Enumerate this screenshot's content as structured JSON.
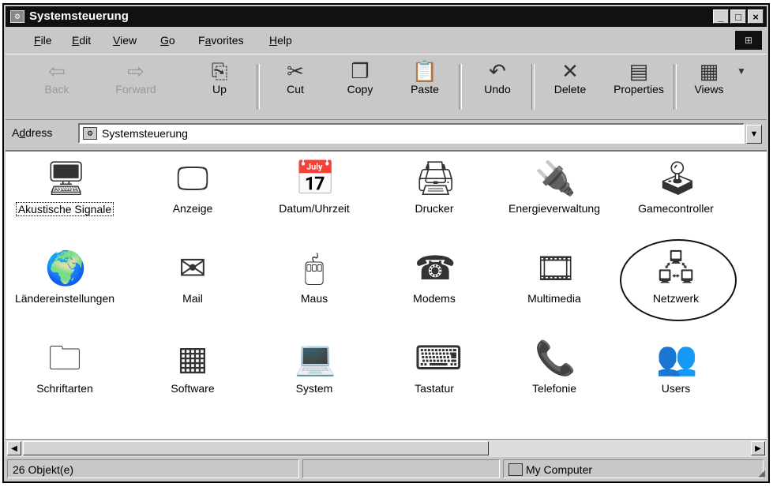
{
  "window": {
    "title": "Systemsteuerung"
  },
  "titlebar_buttons": {
    "minimize": "_",
    "maximize": "□",
    "close": "×"
  },
  "menu": [
    {
      "underline": "F",
      "rest": "ile"
    },
    {
      "underline": "E",
      "rest": "dit"
    },
    {
      "underline": "V",
      "rest": "iew"
    },
    {
      "underline": "G",
      "rest": "o"
    },
    {
      "underline": "a",
      "prefix": "F",
      "rest": "vorites"
    },
    {
      "underline": "H",
      "rest": "elp"
    }
  ],
  "toolbar": {
    "back": "Back",
    "forward": "Forward",
    "up": "Up",
    "cut": "Cut",
    "copy": "Copy",
    "paste": "Paste",
    "undo": "Undo",
    "delete": "Delete",
    "properties": "Properties",
    "views": "Views"
  },
  "address": {
    "label_u": "d",
    "label_prefix": "A",
    "label_rest": "dress",
    "value": "Systemsteuerung"
  },
  "items": [
    {
      "label": "Akustische Signale",
      "icon": "speaker-computer-icon"
    },
    {
      "label": "Anzeige",
      "icon": "monitor-icon"
    },
    {
      "label": "Datum/Uhrzeit",
      "icon": "calendar-clock-icon"
    },
    {
      "label": "Drucker",
      "icon": "printer-folder-icon"
    },
    {
      "label": "Energieverwaltung",
      "icon": "power-plug-icon"
    },
    {
      "label": "Gamecontroller",
      "icon": "joystick-icon"
    },
    {
      "label": "Ländereinstellungen",
      "icon": "globe-icon"
    },
    {
      "label": "Mail",
      "icon": "mail-icon"
    },
    {
      "label": "Maus",
      "icon": "mouse-icon"
    },
    {
      "label": "Modems",
      "icon": "telephone-modem-icon"
    },
    {
      "label": "Multimedia",
      "icon": "multimedia-icon"
    },
    {
      "label": "Netzwerk",
      "icon": "network-icon"
    },
    {
      "label": "Schriftarten",
      "icon": "fonts-folder-icon"
    },
    {
      "label": "Software",
      "icon": "software-icon"
    },
    {
      "label": "System",
      "icon": "system-computer-icon"
    },
    {
      "label": "Tastatur",
      "icon": "keyboard-icon"
    },
    {
      "label": "Telefonie",
      "icon": "telephony-icon"
    },
    {
      "label": "Users",
      "icon": "users-icon"
    }
  ],
  "status": {
    "count": "26 Objekt(e)",
    "zone": "My Computer"
  }
}
